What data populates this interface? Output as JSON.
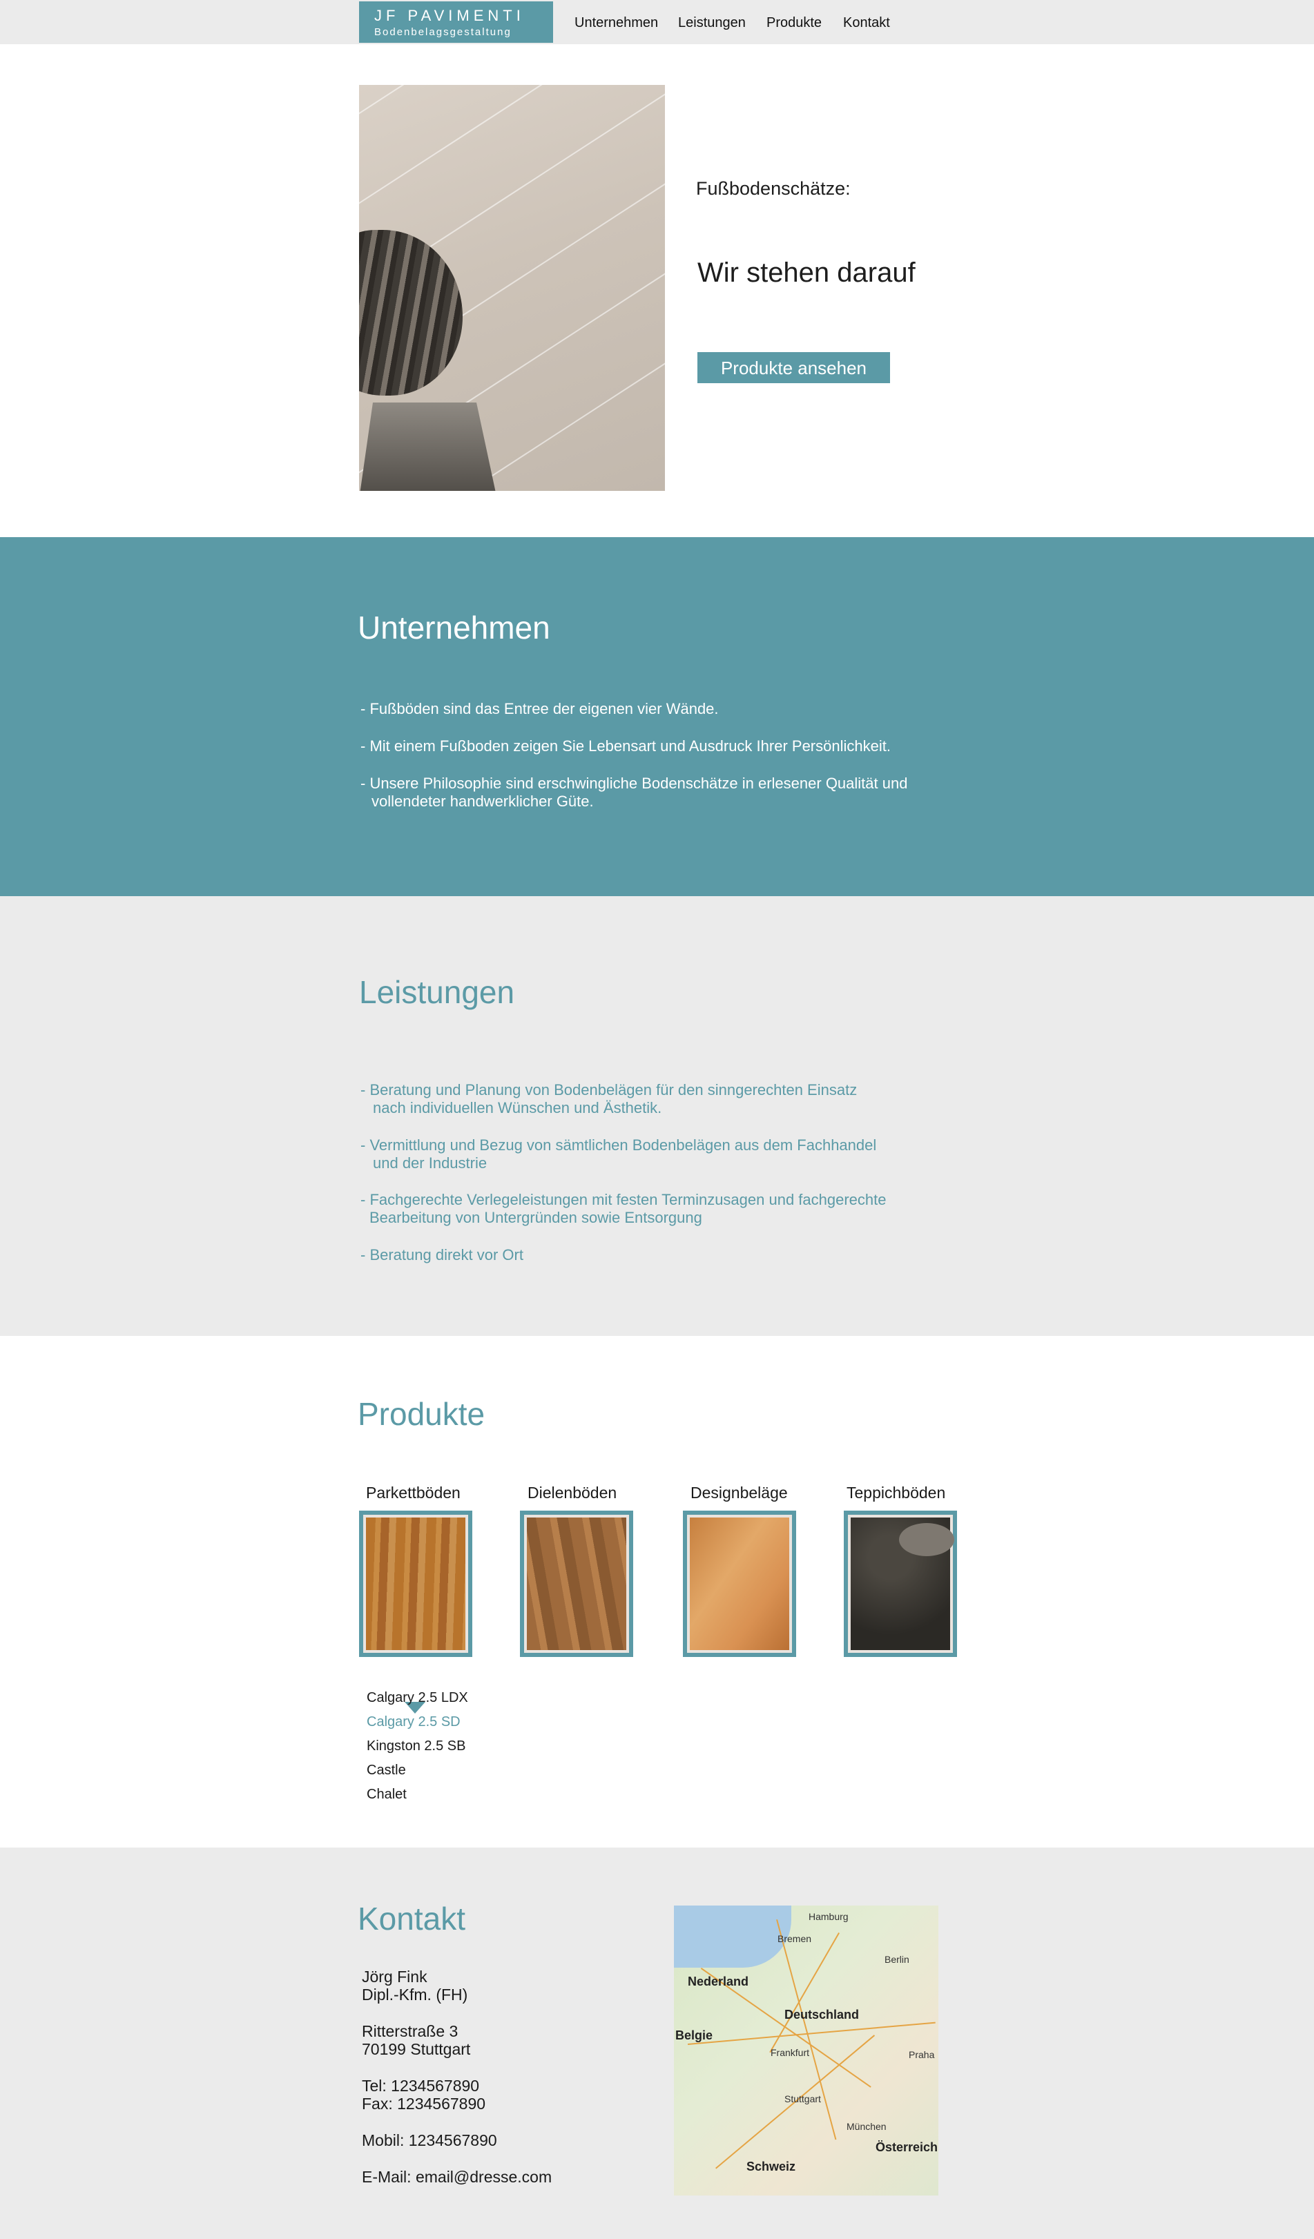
{
  "header": {
    "logo_line1": "JF PAVIMENTI",
    "logo_line2": "Bodenbelagsgestaltung",
    "nav": [
      "Unternehmen",
      "Leistungen",
      "Produkte",
      "Kontakt"
    ]
  },
  "hero": {
    "subtitle": "Fußbodenschätze:",
    "title": "Wir stehen darauf",
    "button_label": "Produkte ansehen"
  },
  "unternehmen": {
    "title": "Unternehmen",
    "items": [
      "- Fußböden sind das Entree der eigenen vier Wände.",
      "- Mit einem Fußboden zeigen Sie Lebensart und Ausdruck Ihrer Persönlichkeit.",
      "- Unsere Philosophie sind erschwingliche Bodenschätze in erlesener Qualität und",
      "vollendeter handwerklicher Güte."
    ]
  },
  "leistungen": {
    "title": "Leistungen",
    "items": [
      "- Beratung und Planung von Bodenbelägen für den sinngerechten Einsatz",
      "nach individuellen Wünschen und Ästhetik.",
      "- Vermittlung und Bezug von sämtlichen Bodenbelägen aus dem Fachhandel",
      "und der Industrie",
      "- Fachgerechte Verlegeleistungen mit festen Terminzusagen und fachgerechte",
      "Bearbeitung von Untergründen sowie Entsorgung",
      "- Beratung direkt vor Ort"
    ]
  },
  "produkte": {
    "title": "Produkte",
    "categories": [
      "Parkettböden",
      "Dielenböden",
      "Designbeläge",
      "Teppichböden"
    ],
    "variants": [
      "Calgary 2.5 LDX",
      "Calgary 2.5 SD",
      "Kingston 2.5 SB",
      "Castle",
      "Chalet"
    ],
    "active_variant": "Calgary 2.5 SD"
  },
  "kontakt": {
    "title": "Kontakt",
    "lines": [
      "Jörg Fink",
      "Dipl.-Kfm. (FH)",
      "Ritterstraße 3",
      "70199 Stuttgart",
      "Tel: 1234567890",
      "Fax: 1234567890",
      "Mobil: 1234567890",
      "E-Mail: email@dresse.com"
    ],
    "map_labels": [
      "Hamburg",
      "Bremen",
      "Nederland",
      "Deutschland",
      "Berlin",
      "Belgie",
      "Frankfurt",
      "Stuttgart",
      "München",
      "Schweiz",
      "Praha",
      "Österreich"
    ]
  },
  "colors": {
    "accent": "#5b9aa6",
    "light_gray": "#ebebeb",
    "text": "#1a1a1a"
  }
}
